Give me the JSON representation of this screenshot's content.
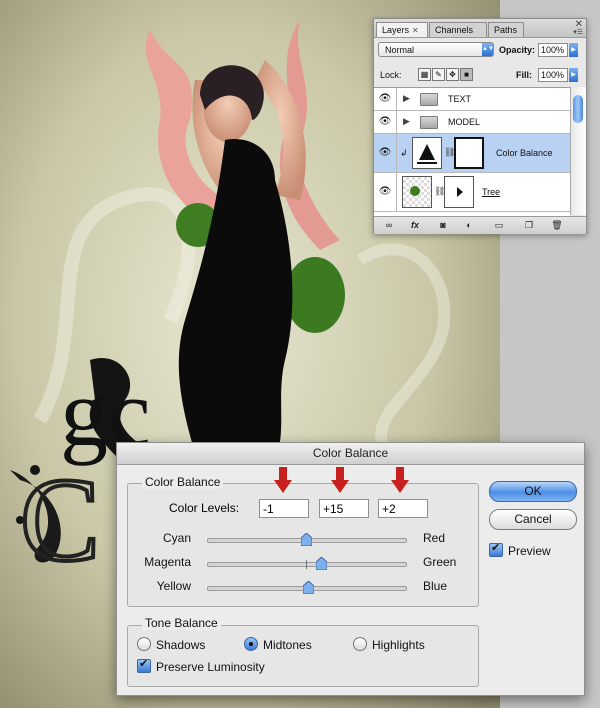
{
  "layers_panel": {
    "tabs": [
      {
        "label": "Layers",
        "active": true,
        "close": "✕"
      },
      {
        "label": "Channels",
        "active": false
      },
      {
        "label": "Paths",
        "active": false
      }
    ],
    "close_glyph": "✕",
    "blend_mode": "Normal",
    "opacity_label": "Opacity:",
    "opacity_value": "100%",
    "lock_label": "Lock:",
    "fill_label": "Fill:",
    "fill_value": "100%",
    "layers": [
      {
        "name": "TEXT",
        "type": "group",
        "visible": true
      },
      {
        "name": "MODEL",
        "type": "group",
        "visible": true
      },
      {
        "name": "Color Balance",
        "type": "adjustment",
        "visible": true,
        "selected": true
      },
      {
        "name": "Tree",
        "type": "pixel",
        "visible": true
      }
    ],
    "footer_icons": [
      "link-icon",
      "fx-icon",
      "mask-icon",
      "adjustment-icon",
      "new-group-icon",
      "new-layer-icon",
      "trash-icon"
    ],
    "footer_fx": "fx"
  },
  "dialog": {
    "title": "Color Balance",
    "color_balance_group": "Color Balance",
    "color_levels_label": "Color Levels:",
    "levels": [
      "-1",
      "+15",
      "+2"
    ],
    "sliders": [
      {
        "left": "Cyan",
        "right": "Red",
        "value": -1
      },
      {
        "left": "Magenta",
        "right": "Green",
        "value": 15
      },
      {
        "left": "Yellow",
        "right": "Blue",
        "value": 2
      }
    ],
    "tone_group": "Tone Balance",
    "tones": [
      {
        "label": "Shadows",
        "selected": false
      },
      {
        "label": "Midtones",
        "selected": true
      },
      {
        "label": "Highlights",
        "selected": false
      }
    ],
    "preserve_luminosity": "Preserve Luminosity",
    "ok_label": "OK",
    "cancel_label": "Cancel",
    "preview_label": "Preview",
    "accent_color": "#3c7ad6",
    "arrow_color": "#c8201e"
  },
  "artwork": {
    "letters_top": "gc",
    "letters_bottom": "C"
  }
}
